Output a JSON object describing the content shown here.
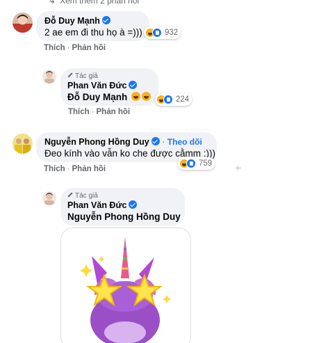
{
  "top": {
    "more_replies": "Xem thêm 2 phản hồi"
  },
  "comments": [
    {
      "author": "Đỗ Duy Mạnh",
      "text": "2 ae em đi thu họ à =)))",
      "reaction_count": "932",
      "actions": {
        "like": "Thích",
        "reply": "Phản hồi"
      }
    },
    {
      "author_tag": "Tác giả",
      "author": "Phan Văn Đức",
      "text": "Đỗ Duy Mạnh",
      "reaction_count": "224",
      "actions": {
        "like": "Thích",
        "reply": "Phản hồi"
      }
    },
    {
      "author": "Nguyễn Phong Hồng Duy",
      "follow": "Theo dõi",
      "text": "Đeo kính vào vẫn ko che được cằmm :)))",
      "reaction_count": "759",
      "actions": {
        "like": "Thích",
        "reply": "Phản hồi"
      }
    },
    {
      "author_tag": "Tác giả",
      "author": "Phan Văn Đức",
      "text": "Nguyễn Phong Hồng Duy"
    }
  ],
  "colors": {
    "bubble": "#f0f2f5",
    "link": "#1877f2",
    "secondary_text": "#65676b"
  },
  "icons": [
    "chevron-right-icon",
    "verified-icon",
    "haha-reaction-icon",
    "like-reaction-icon",
    "pencil-icon",
    "unicorn-sticker"
  ]
}
